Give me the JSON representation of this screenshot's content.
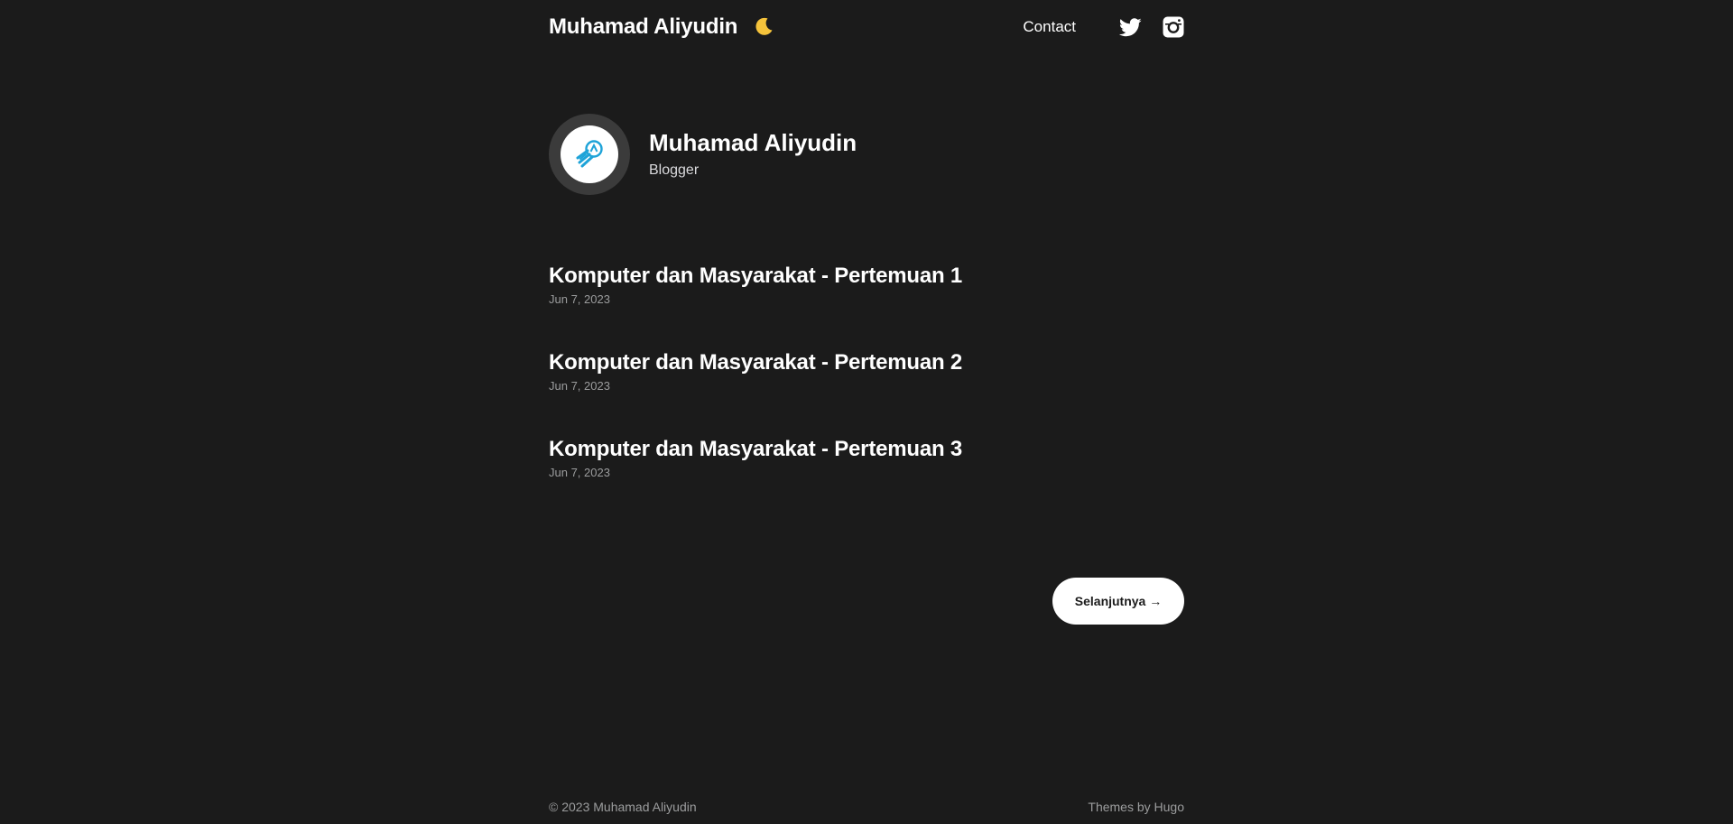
{
  "header": {
    "site_title": "Muhamad Aliyudin",
    "theme_toggle_icon": "moon-icon",
    "nav": [
      {
        "label": "Contact"
      }
    ],
    "social": [
      {
        "name": "Twitter",
        "icon": "twitter-icon"
      },
      {
        "name": "Instagram",
        "icon": "instagram-icon"
      }
    ]
  },
  "profile": {
    "name": "Muhamad Aliyudin",
    "role": "Blogger",
    "avatar_icon": "rocket-logo-icon"
  },
  "posts": [
    {
      "title": "Komputer dan Masyarakat - Pertemuan 1",
      "date": "Jun 7, 2023"
    },
    {
      "title": "Komputer dan Masyarakat - Pertemuan 2",
      "date": "Jun 7, 2023"
    },
    {
      "title": "Komputer dan Masyarakat - Pertemuan 3",
      "date": "Jun 7, 2023"
    }
  ],
  "pagination": {
    "next_label": "Selanjutnya →"
  },
  "footer": {
    "copyright": "© 2023 Muhamad Aliyudin",
    "credit": "Themes by Hugo"
  },
  "colors": {
    "background": "#1b1b1b",
    "text": "#ffffff",
    "muted": "#9b9c9d",
    "avatar_ring": "#3b3b3b",
    "logo_blue": "#1ea3d8",
    "moon": "#f5c33b"
  }
}
